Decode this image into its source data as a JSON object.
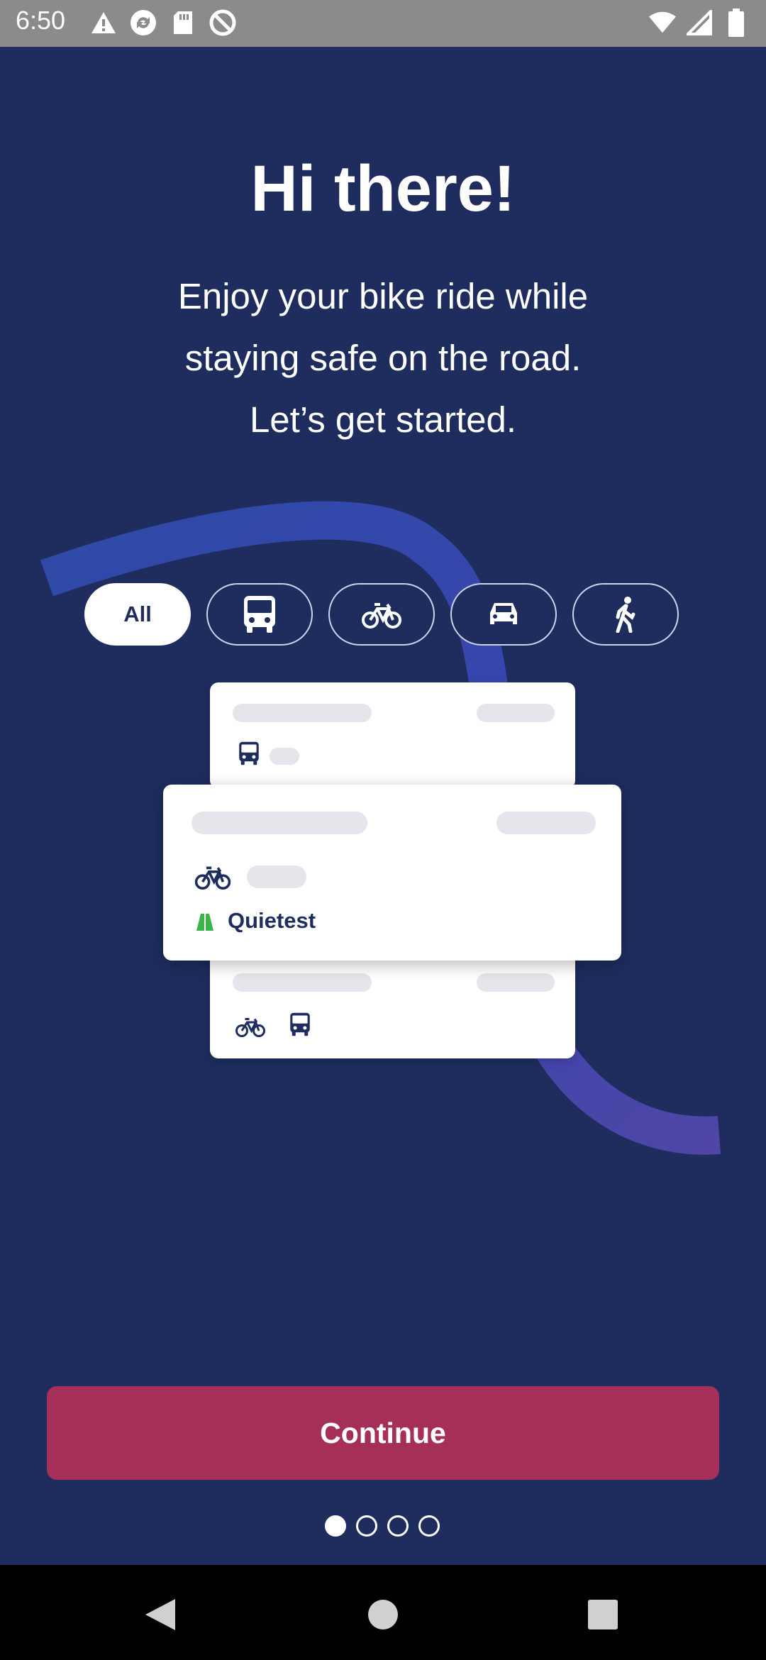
{
  "status_bar": {
    "time": "6:50",
    "left_icons": [
      "warning-icon",
      "sync-icon",
      "sd-card-icon",
      "no-sim-icon"
    ],
    "right_icons": [
      "wifi-icon",
      "signal-icon",
      "battery-icon"
    ]
  },
  "onboarding": {
    "title": "Hi there!",
    "subtitle_lines": [
      "Enjoy your bike ride while",
      "staying safe on the road.",
      "Let’s get started."
    ]
  },
  "filter_chips": [
    {
      "label": "All",
      "active": true
    },
    {
      "icon": "bus-icon",
      "active": false
    },
    {
      "icon": "bicycle-icon",
      "active": false
    },
    {
      "icon": "car-icon",
      "active": false
    },
    {
      "icon": "walk-icon",
      "active": false
    }
  ],
  "cards": {
    "middle_tag": "Quietest"
  },
  "continue_button": {
    "label": "Continue"
  },
  "pager": {
    "count": 4,
    "active": 0
  },
  "colors": {
    "background": "#1e2d5e",
    "accent": "#a52f58",
    "arc": "#3b4fae"
  }
}
